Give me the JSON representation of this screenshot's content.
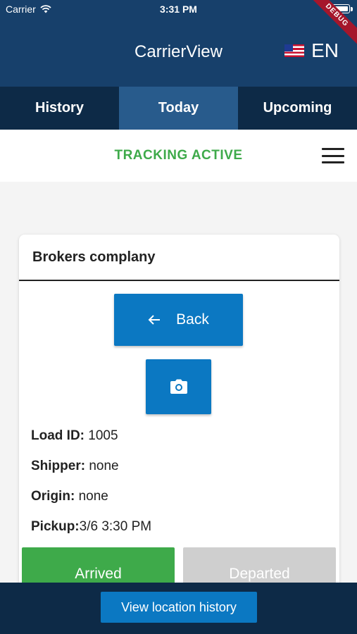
{
  "status_bar": {
    "carrier": "Carrier",
    "time": "3:31 PM",
    "icons": [
      "wifi-icon",
      "battery-icon"
    ]
  },
  "app_bar": {
    "title": "CarrierView",
    "language_code": "EN",
    "flag": "us-flag-icon",
    "debug_banner": "DEBUG"
  },
  "tabs": [
    {
      "label": "History",
      "active": false
    },
    {
      "label": "Today",
      "active": true
    },
    {
      "label": "Upcoming",
      "active": false
    }
  ],
  "tracking": {
    "status": "TRACKING ACTIVE",
    "menu_icon": "hamburger-menu-icon"
  },
  "card": {
    "title": "Brokers complany",
    "back_label": "Back",
    "back_icon": "arrow-left-icon",
    "camera_icon": "camera-icon",
    "fields": [
      {
        "label": "Load ID:",
        "value": "1005"
      },
      {
        "label": "Shipper:",
        "value": "none"
      },
      {
        "label": "Origin:",
        "value": "none"
      },
      {
        "label": "Pickup:",
        "value": "3/6 3:30 PM"
      }
    ],
    "arrived_label": "Arrived",
    "departed_label": "Departed"
  },
  "bottom": {
    "history_button": "View location history"
  },
  "colors": {
    "primary_dark": "#17406b",
    "tab_bg": "#0d2a47",
    "tab_active": "#285b8c",
    "accent_blue": "#0b78c2",
    "success_green": "#3eaa4a",
    "disabled_gray": "#cfcfcf"
  }
}
